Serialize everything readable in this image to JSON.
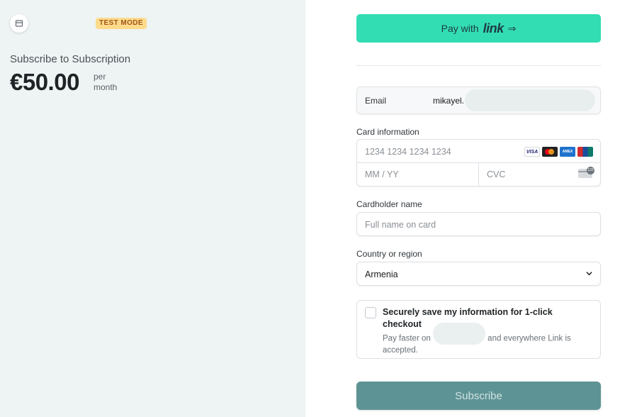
{
  "summary": {
    "badge": "TEST MODE",
    "title": "Subscribe to Subscription",
    "price": "€50.00",
    "period_line1": "per",
    "period_line2": "month"
  },
  "link": {
    "prefix": "Pay with",
    "brand": "link",
    "arrow": "⇒"
  },
  "email": {
    "label": "Email",
    "value": "mikayel."
  },
  "card": {
    "label": "Card information",
    "number_placeholder": "1234 1234 1234 1234",
    "expiry_placeholder": "MM / YY",
    "cvc_placeholder": "CVC",
    "brands": [
      "VISA",
      "Mastercard",
      "AMEX",
      "UnionPay"
    ],
    "cvc_icon_text": "123"
  },
  "cardholder": {
    "label": "Cardholder name",
    "placeholder": "Full name on card"
  },
  "country": {
    "label": "Country or region",
    "value": "Armenia"
  },
  "save": {
    "title": "Securely save my information for 1-click checkout",
    "desc_before": "Pay faster on",
    "desc_after": "and everywhere Link is accepted."
  },
  "subscribe_label": "Subscribe",
  "colors": {
    "left_bg": "#eef3f3",
    "link_green": "#33ddb3",
    "subscribe_bg": "#5e9395",
    "badge_bg": "#fddb8a"
  }
}
